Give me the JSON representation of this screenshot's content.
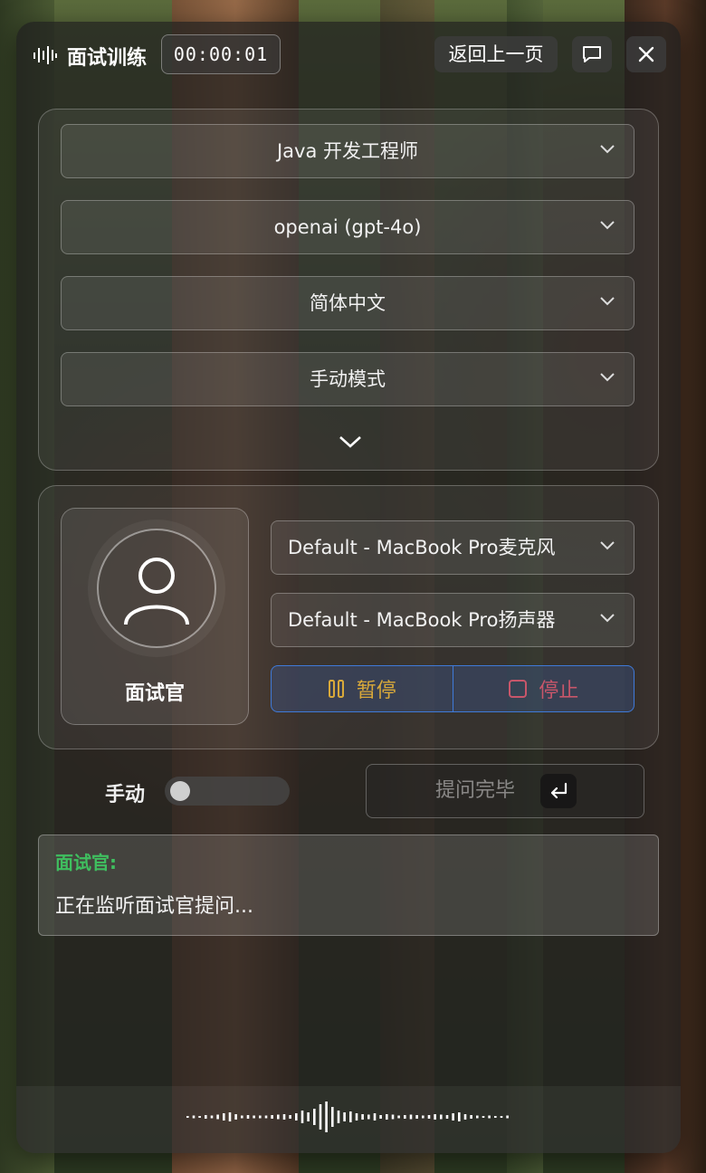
{
  "header": {
    "title": "面试训练",
    "timer": "00:00:01",
    "back_label": "返回上一页"
  },
  "settings": {
    "selects": [
      {
        "value": "Java 开发工程师"
      },
      {
        "value": "openai (gpt-4o)"
      },
      {
        "value": "简体中文"
      },
      {
        "value": "手动模式"
      }
    ]
  },
  "device": {
    "avatar_label": "面试官",
    "mic_select": "Default - MacBook Pro麦克风",
    "speaker_select": "Default - MacBook Pro扬声器",
    "pause_label": "暂停",
    "stop_label": "停止"
  },
  "controls": {
    "mode_label": "手动",
    "toggle_on": false,
    "done_label": "提问完毕"
  },
  "transcript": {
    "speaker": "面试官:",
    "text": "正在监听面试官提问..."
  },
  "colors": {
    "speaker_green": "#3fbf5f",
    "pause_amber": "#d9a93a",
    "stop_red": "#c8566a",
    "accent_blue": "#3f7ad9"
  }
}
